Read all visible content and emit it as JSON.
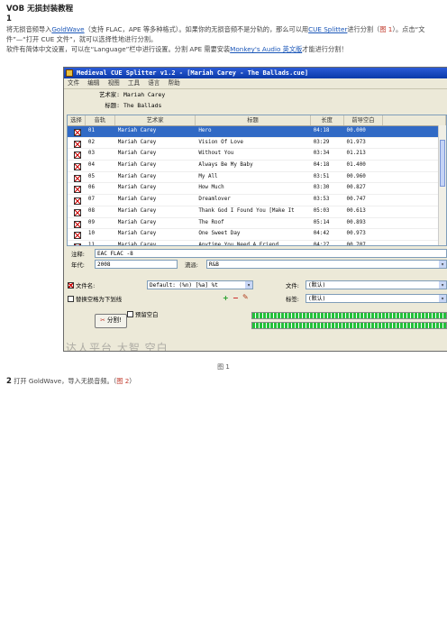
{
  "doc": {
    "title": "VOB 无损封装教程",
    "step1_number": "1",
    "para1_a": "将无损音频导入",
    "para1_link1": "GoldWave",
    "para1_b": "（支持 FLAC，APE 等多种格式）。如果你的无损音频不是分轨的，那么可以用",
    "para1_link2": "CUE Splitter",
    "para1_c": "进行分割（",
    "para1_ref": "图 1",
    "para1_d": "）。点击“文件”—“打开 CUE 文件”，就可以选择性地进行分割。",
    "para2_a": "软件有简体中文设置，可以在“Language”栏中进行设置。分割 APE 需要安装",
    "para2_link": "Monkey's Audio 英文版",
    "para2_b": "才能进行分割！",
    "caption": "图 1",
    "step2_number": "2",
    "step2_a": "打开 GoldWave，导入无损音频。（",
    "step2_ref": "图 2",
    "step2_b": "）"
  },
  "app": {
    "title": "Medieval CUE Splitter v1.2 - [Mariah Carey - The Ballads.cue]",
    "menu": [
      "文件",
      "编辑",
      "视图",
      "工具",
      "语言",
      "帮助"
    ],
    "artist_label": "艺术家:",
    "artist_value": "Mariah Carey",
    "title_label": "标题:",
    "title_value": "The Ballads",
    "columns": [
      "选择",
      "音轨",
      "艺术家",
      "标题",
      "长度",
      "前导空白"
    ],
    "tracks": [
      {
        "n": "01",
        "artist": "Mariah Carey",
        "title": "Hero",
        "length": "04:18",
        "gap": "00.000"
      },
      {
        "n": "02",
        "artist": "Mariah Carey",
        "title": "Vision Of Love",
        "length": "03:29",
        "gap": "01.973"
      },
      {
        "n": "03",
        "artist": "Mariah Carey",
        "title": "Without You",
        "length": "03:34",
        "gap": "01.213"
      },
      {
        "n": "04",
        "artist": "Mariah Carey",
        "title": "Always Be My Baby",
        "length": "04:18",
        "gap": "01.400"
      },
      {
        "n": "05",
        "artist": "Mariah Carey",
        "title": "My All",
        "length": "03:51",
        "gap": "00.960"
      },
      {
        "n": "06",
        "artist": "Mariah Carey",
        "title": "How Much",
        "length": "03:30",
        "gap": "00.827"
      },
      {
        "n": "07",
        "artist": "Mariah Carey",
        "title": "Dreamlover",
        "length": "03:53",
        "gap": "00.747"
      },
      {
        "n": "08",
        "artist": "Mariah Carey",
        "title": "Thank God I Found You [Make It",
        "length": "05:03",
        "gap": "00.613"
      },
      {
        "n": "09",
        "artist": "Mariah Carey",
        "title": "The Roof",
        "length": "05:14",
        "gap": "00.893"
      },
      {
        "n": "10",
        "artist": "Mariah Carey",
        "title": "One Sweet Day",
        "length": "04:42",
        "gap": "00.973"
      },
      {
        "n": "11",
        "artist": "Mariah Carey",
        "title": "Anytime You Need A Friend",
        "length": "04:27",
        "gap": "00.707"
      }
    ],
    "comment_label": "注释:",
    "comment_value": "EAC FLAC -8",
    "year_label": "年代:",
    "year_value": "2008",
    "genre_label": "流派:",
    "genre_value": "R&B",
    "filename_label": "文件名:",
    "filename_value": "Default: (%n) [%a] %t",
    "file_label": "文件:",
    "file_value": "(默认)",
    "tag_label": "标签:",
    "tag_value": "(默认)",
    "underscore_label": "替换空格为下划线",
    "split_label": "分割!",
    "pregap_label": "预留空白",
    "progress_top": 1.0,
    "progress_bottom": 1.0
  },
  "watermark": "达人平台 大智 空白"
}
